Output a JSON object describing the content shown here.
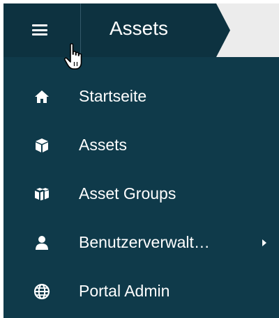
{
  "header": {
    "title": "Assets",
    "menu_icon": "hamburger-menu-icon"
  },
  "colors": {
    "sidebar_bg": "#0f3a4a",
    "header_bg": "#0d3240",
    "text": "#ffffff",
    "header_tail": "#ececec"
  },
  "sidebar": {
    "items": [
      {
        "label": "Startseite",
        "icon": "home-icon"
      },
      {
        "label": "Assets",
        "icon": "cube-icon"
      },
      {
        "label": "Asset Groups",
        "icon": "cubes-icon"
      },
      {
        "label": "Benutzerverwalt…",
        "icon": "user-icon",
        "has_submenu": true
      },
      {
        "label": "Portal Admin",
        "icon": "globe-icon"
      }
    ]
  }
}
